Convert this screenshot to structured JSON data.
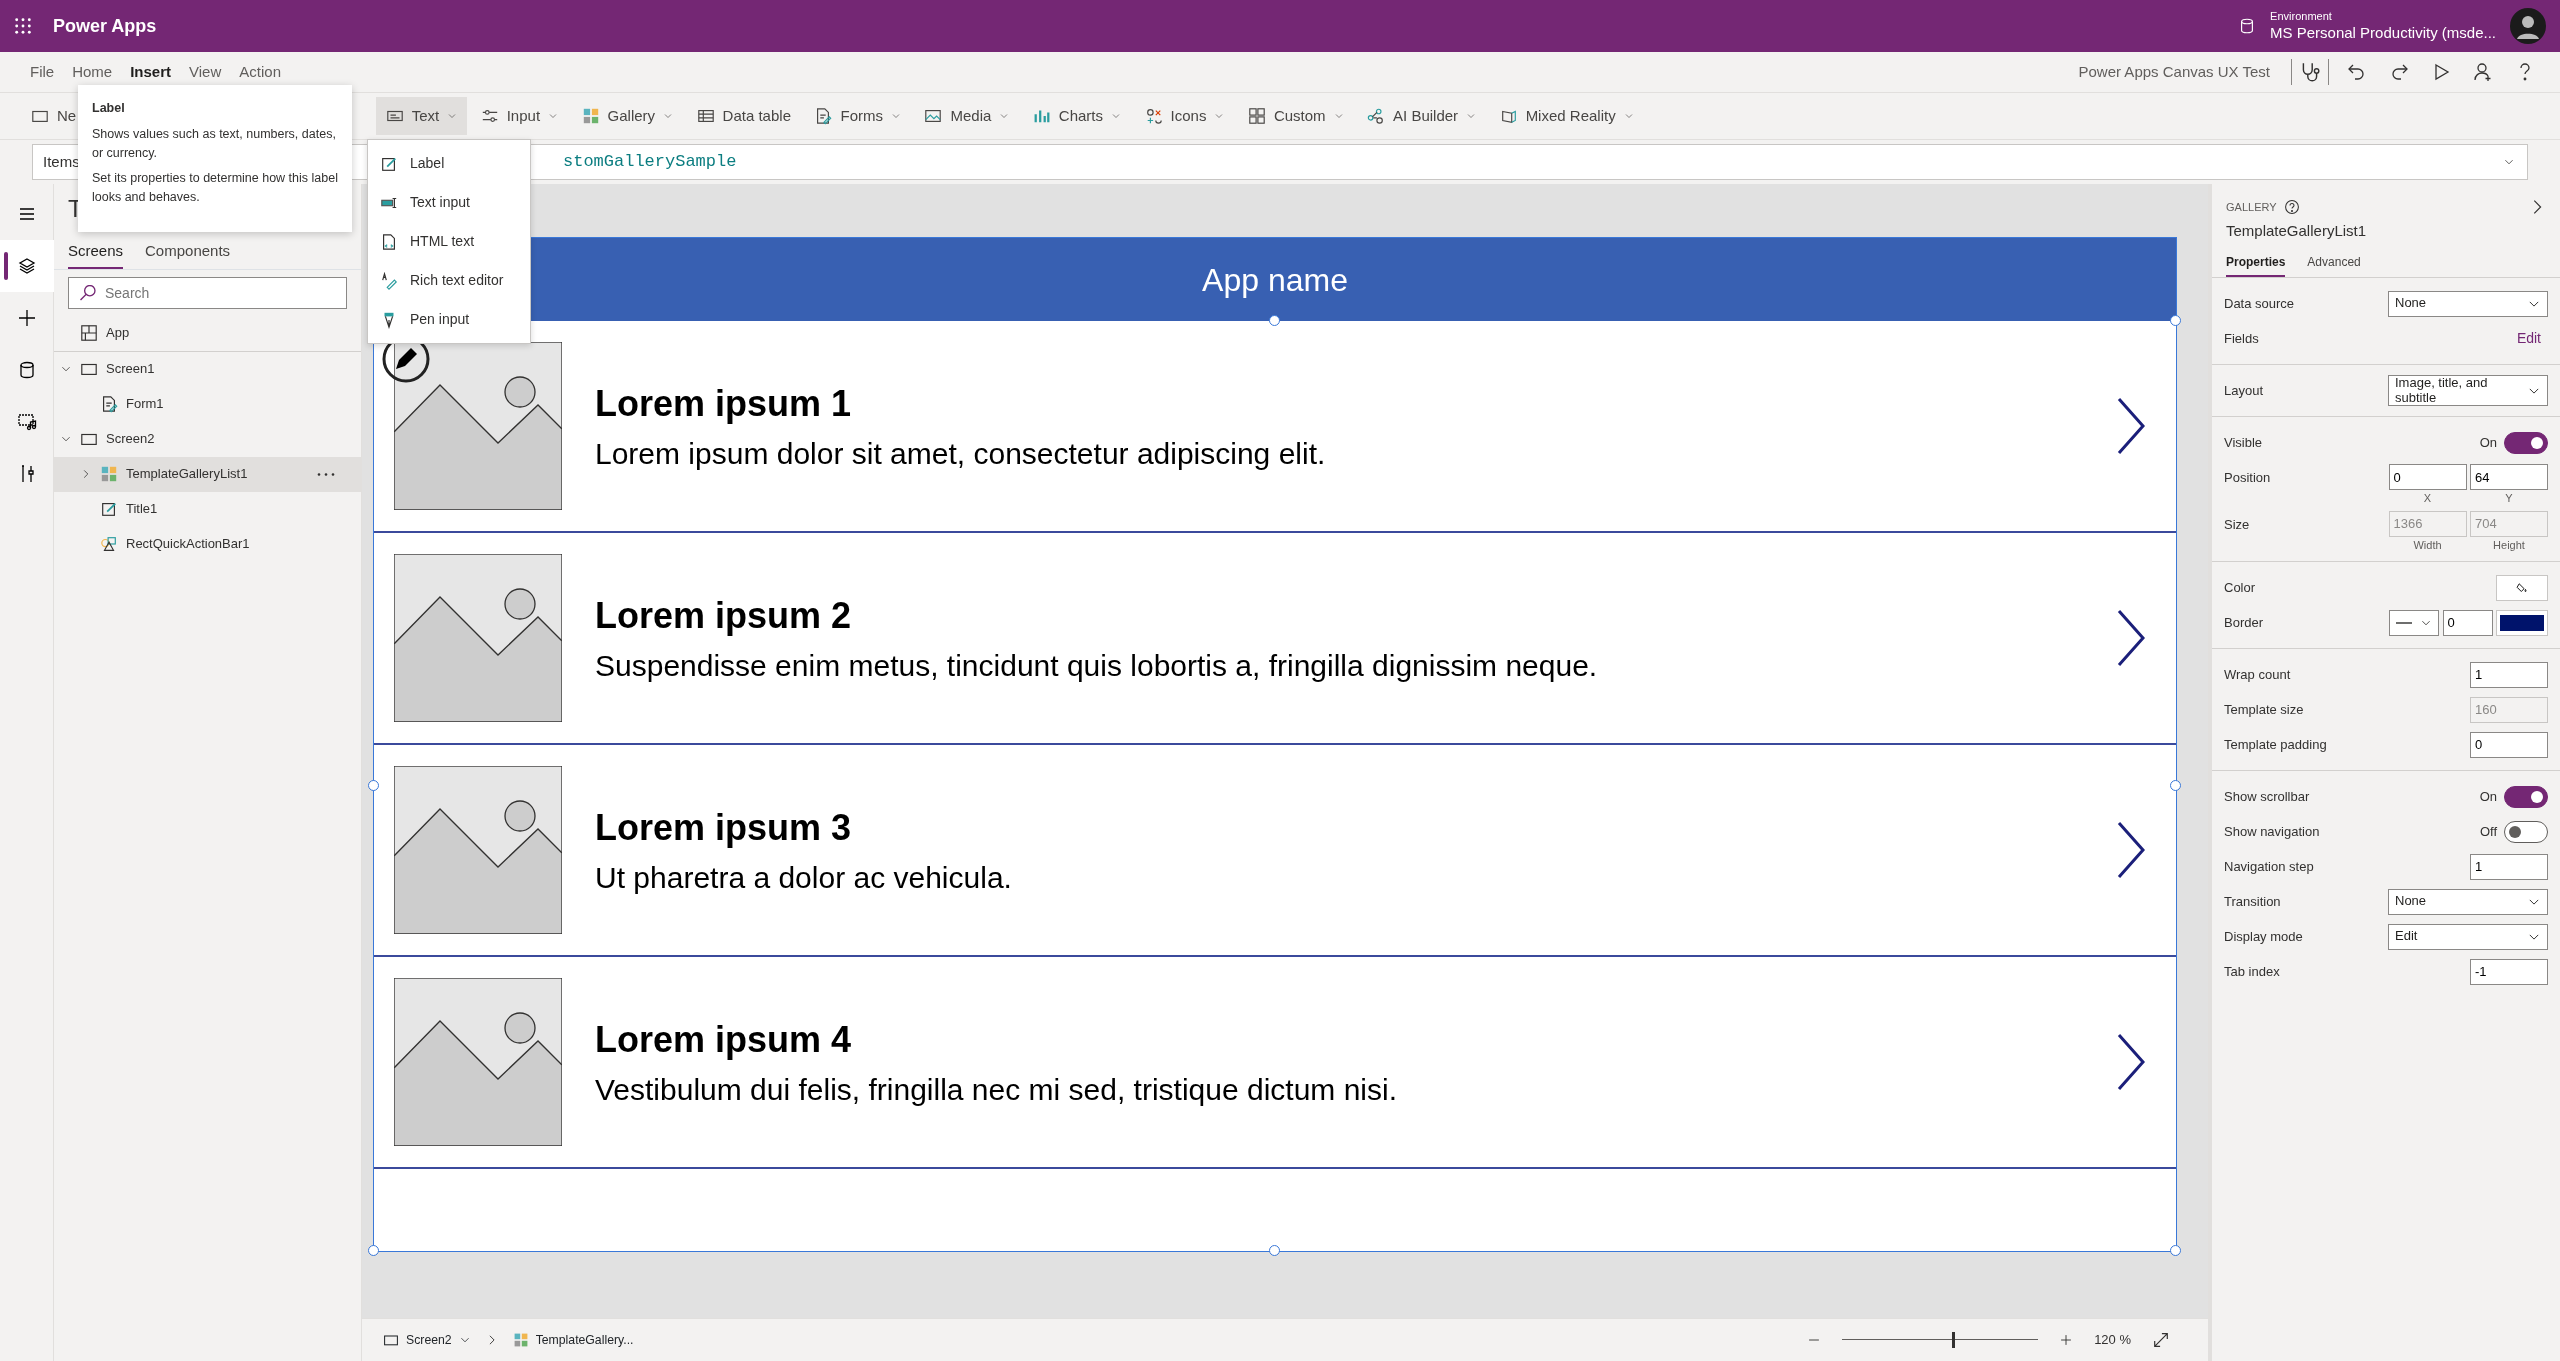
{
  "app_bar": {
    "title": "Power Apps",
    "environment_label": "Environment",
    "environment": "MS Personal Productivity (msde..."
  },
  "menu": [
    {
      "label": "File",
      "selected": false
    },
    {
      "label": "Home",
      "selected": false
    },
    {
      "label": "Insert",
      "selected": true
    },
    {
      "label": "View",
      "selected": false
    },
    {
      "label": "Action",
      "selected": false
    }
  ],
  "app_name": "Power Apps Canvas UX Test",
  "toolbar": [
    {
      "label": "Ne",
      "kind": "screen",
      "menu": false,
      "expanded": false
    },
    {
      "label": "Text",
      "kind": "text",
      "menu": true,
      "expanded": true
    },
    {
      "label": "Input",
      "kind": "input",
      "menu": true,
      "expanded": false
    },
    {
      "label": "Gallery",
      "kind": "gallery",
      "menu": true,
      "expanded": false
    },
    {
      "label": "Data table",
      "kind": "table",
      "menu": false,
      "expanded": false
    },
    {
      "label": "Forms",
      "kind": "form",
      "menu": true,
      "expanded": false
    },
    {
      "label": "Media",
      "kind": "media",
      "menu": true,
      "expanded": false
    },
    {
      "label": "Charts",
      "kind": "chart",
      "menu": true,
      "expanded": false
    },
    {
      "label": "Icons",
      "kind": "icons",
      "menu": true,
      "expanded": false
    },
    {
      "label": "Custom",
      "kind": "custom",
      "menu": true,
      "expanded": false
    },
    {
      "label": "AI Builder",
      "kind": "ai",
      "menu": true,
      "expanded": false
    },
    {
      "label": "Mixed Reality",
      "kind": "mr",
      "menu": true,
      "expanded": false
    }
  ],
  "formula_bar": {
    "property": "Items",
    "formula": "stomGallerySample"
  },
  "tooltip": {
    "title": "Label",
    "paragraphs": [
      "Shows values such as text, numbers, dates, or currency.",
      "Set its properties to determine how this label looks and behaves."
    ]
  },
  "insert_menu": [
    {
      "label": "Label",
      "kind": "label"
    },
    {
      "label": "Text input",
      "kind": "textinput"
    },
    {
      "label": "HTML text",
      "kind": "html"
    },
    {
      "label": "Rich text editor",
      "kind": "rich"
    },
    {
      "label": "Pen input",
      "kind": "pen"
    }
  ],
  "rail": [
    {
      "kind": "menu",
      "selected": false
    },
    {
      "kind": "tree",
      "selected": true
    },
    {
      "kind": "plus",
      "selected": false
    },
    {
      "kind": "data",
      "selected": false
    },
    {
      "kind": "media",
      "selected": false
    },
    {
      "kind": "tools",
      "selected": false
    }
  ],
  "tree_panel": {
    "title": "T",
    "tabs": [
      {
        "label": "Screens",
        "selected": true
      },
      {
        "label": "Components",
        "selected": false
      }
    ],
    "search": {
      "placeholder": "Search"
    },
    "items": [
      {
        "label": "App",
        "kind": "app",
        "selected": false
      },
      {
        "label": "Screen1",
        "kind": "screen",
        "expanded": true,
        "selected": false,
        "children": [
          {
            "label": "Form1",
            "kind": "form",
            "selected": false
          }
        ]
      },
      {
        "label": "Screen2",
        "kind": "screen",
        "expanded": true,
        "selected": false,
        "children": [
          {
            "label": "TemplateGalleryList1",
            "kind": "gallery",
            "expanded": false,
            "selected": true
          },
          {
            "label": "Title1",
            "kind": "label",
            "selected": false
          },
          {
            "label": "RectQuickActionBar1",
            "kind": "shapes",
            "selected": false
          }
        ]
      }
    ]
  },
  "canvas": {
    "header": "App name",
    "items": [
      {
        "title": "Lorem ipsum 1",
        "subtitle": "Lorem ipsum dolor sit amet, consectetur adipiscing elit."
      },
      {
        "title": "Lorem ipsum 2",
        "subtitle": "Suspendisse enim metus, tincidunt quis lobortis a, fringilla dignissim neque."
      },
      {
        "title": "Lorem ipsum 3",
        "subtitle": "Ut pharetra a dolor ac vehicula."
      },
      {
        "title": "Lorem ipsum 4",
        "subtitle": "Vestibulum dui felis, fringilla nec mi sed, tristique dictum nisi."
      }
    ]
  },
  "properties": {
    "type_label": "GALLERY",
    "name": "TemplateGalleryList1",
    "tabs": [
      {
        "label": "Properties",
        "selected": true
      },
      {
        "label": "Advanced",
        "selected": false
      }
    ],
    "sections": [
      [
        {
          "kind": "select",
          "label": "Data source",
          "value": "None"
        },
        {
          "kind": "link",
          "label": "Fields",
          "link": "Edit"
        }
      ],
      [
        {
          "kind": "select",
          "label": "Layout",
          "value": "Image, title, and subtitle"
        }
      ],
      [
        {
          "kind": "toggle",
          "label": "Visible",
          "state_text": "On",
          "on": true
        },
        {
          "kind": "pair",
          "label": "Position",
          "fields": [
            {
              "value": "0",
              "caption": "X",
              "disabled": false
            },
            {
              "value": "64",
              "caption": "Y",
              "disabled": false
            }
          ]
        },
        {
          "kind": "pair",
          "label": "Size",
          "fields": [
            {
              "value": "1366",
              "caption": "Width",
              "disabled": true
            },
            {
              "value": "704",
              "caption": "Height",
              "disabled": true
            }
          ]
        }
      ],
      [
        {
          "kind": "color",
          "label": "Color"
        },
        {
          "kind": "border",
          "label": "Border",
          "value": "0"
        }
      ],
      [
        {
          "kind": "number",
          "label": "Wrap count",
          "value": "1",
          "disabled": false
        },
        {
          "kind": "number",
          "label": "Template size",
          "value": "160",
          "disabled": true
        },
        {
          "kind": "number",
          "label": "Template padding",
          "value": "0",
          "disabled": false
        }
      ],
      [
        {
          "kind": "toggle",
          "label": "Show scrollbar",
          "state_text": "On",
          "on": true
        },
        {
          "kind": "toggle",
          "label": "Show navigation",
          "state_text": "Off",
          "on": false
        },
        {
          "kind": "number",
          "label": "Navigation step",
          "value": "1",
          "disabled": false
        },
        {
          "kind": "select",
          "label": "Transition",
          "value": "None"
        },
        {
          "kind": "select",
          "label": "Display mode",
          "value": "Edit"
        },
        {
          "kind": "number",
          "label": "Tab index",
          "value": "-1",
          "disabled": false
        }
      ]
    ]
  },
  "status_bar": {
    "screen": "Screen2",
    "control": "TemplateGallery...",
    "zoom": "120 %",
    "level": 0.56
  }
}
